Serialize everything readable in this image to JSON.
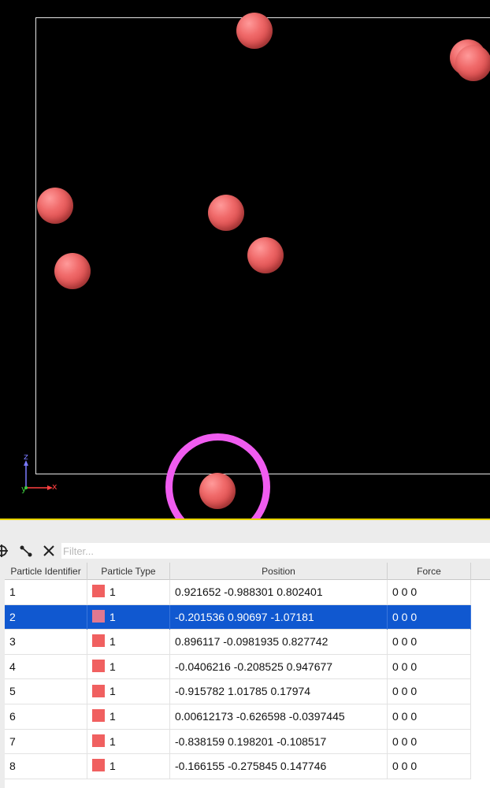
{
  "viewport": {
    "background": "#000000",
    "particle_color": "#f06a6a",
    "highlight_color": "#f05cf0",
    "axes": {
      "z_label": "z",
      "y_label": "y",
      "x_label": "x",
      "z_color": "#7a7aff",
      "y_color": "#3ecb3e",
      "x_color": "#ff4040"
    }
  },
  "toolbar": {
    "icons": [
      "crosshair-icon",
      "bond-icon",
      "close-icon"
    ],
    "filter_placeholder": "Filter..."
  },
  "table": {
    "columns": [
      "Particle Identifier",
      "Particle Type",
      "Position",
      "Force"
    ],
    "selected_row": 2,
    "rows": [
      {
        "id": "1",
        "type": "1",
        "position": "0.921652 -0.988301 0.802401",
        "force": "0 0 0"
      },
      {
        "id": "2",
        "type": "1",
        "position": "-0.201536 0.90697 -1.07181",
        "force": "0 0 0"
      },
      {
        "id": "3",
        "type": "1",
        "position": "0.896117 -0.0981935 0.827742",
        "force": "0 0 0"
      },
      {
        "id": "4",
        "type": "1",
        "position": "-0.0406216 -0.208525 0.947677",
        "force": "0 0 0"
      },
      {
        "id": "5",
        "type": "1",
        "position": "-0.915782 1.01785 0.17974",
        "force": "0 0 0"
      },
      {
        "id": "6",
        "type": "1",
        "position": "0.00612173 -0.626598 -0.0397445",
        "force": "0 0 0"
      },
      {
        "id": "7",
        "type": "1",
        "position": "-0.838159 0.198201 -0.108517",
        "force": "0 0 0"
      },
      {
        "id": "8",
        "type": "1",
        "position": "-0.166155 -0.275845 0.147746",
        "force": "0 0 0"
      }
    ],
    "type_swatch_color": "#f06060",
    "selected_swatch_color": "#e07890"
  }
}
